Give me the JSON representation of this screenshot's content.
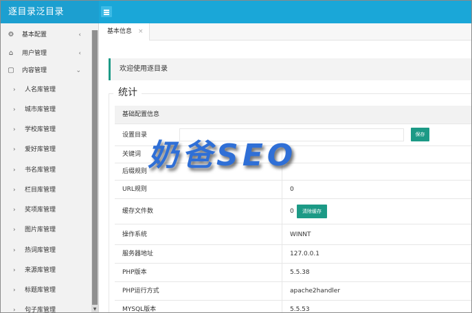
{
  "brand": {
    "title": "逐目录泛目录"
  },
  "sidebar": {
    "groups": [
      {
        "label": "基本配置",
        "icon": "settings-icon",
        "arrow": "‹"
      },
      {
        "label": "用户管理",
        "icon": "home-icon",
        "arrow": "‹"
      },
      {
        "label": "内容管理",
        "icon": "document-icon",
        "arrow": "⌄"
      }
    ],
    "items": [
      {
        "label": "人名库管理"
      },
      {
        "label": "城市库管理"
      },
      {
        "label": "学校库管理"
      },
      {
        "label": "爱好库管理"
      },
      {
        "label": "书名库管理"
      },
      {
        "label": "栏目库管理"
      },
      {
        "label": "奖项库管理"
      },
      {
        "label": "图片库管理"
      },
      {
        "label": "热词库管理"
      },
      {
        "label": "来源库管理"
      },
      {
        "label": "标题库管理"
      },
      {
        "label": "句子库管理"
      }
    ]
  },
  "tabs": [
    {
      "label": "基本信息",
      "close": "×"
    }
  ],
  "main": {
    "welcome": "欢迎使用逐目录",
    "legend": "统计",
    "section_title": "基础配置信息",
    "rows": [
      {
        "key": "设置目录",
        "value": "",
        "button": "保存"
      },
      {
        "key": "关键词",
        "value": ""
      },
      {
        "key": "后缀规则",
        "value": ""
      },
      {
        "key": "URL规则",
        "value": "0"
      },
      {
        "key": "缓存文件数",
        "value": "0",
        "button": "清除缓存"
      },
      {
        "key": "操作系统",
        "value": "WINNT"
      },
      {
        "key": "服务器地址",
        "value": "127.0.0.1"
      },
      {
        "key": "PHP版本",
        "value": "5.5.38"
      },
      {
        "key": "PHP运行方式",
        "value": "apache2handler"
      },
      {
        "key": "MYSQL版本",
        "value": "5.5.53"
      }
    ]
  },
  "watermark": "奶爸SEO",
  "colors": {
    "topbar": "#1aa7d8",
    "accent": "#1c9a86"
  }
}
